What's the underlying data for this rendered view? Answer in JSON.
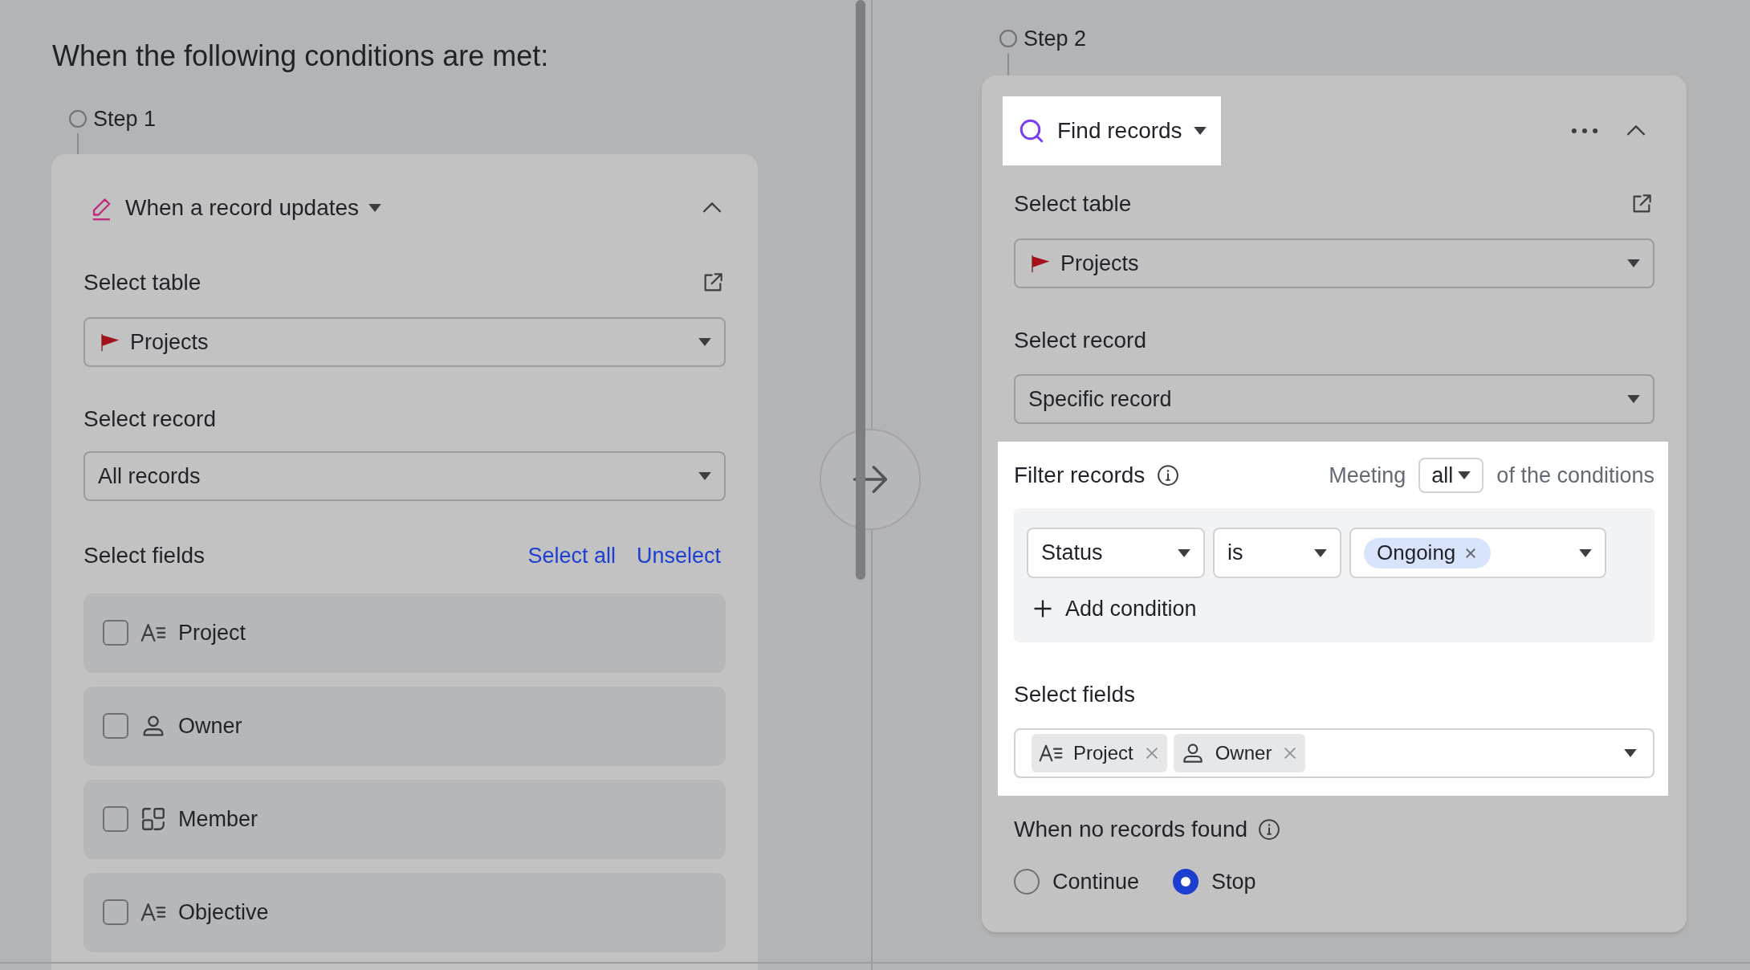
{
  "heading": "When the following conditions are met:",
  "trigger_step": {
    "step": "Step 1",
    "title": "When a record updates",
    "select_table": {
      "label": "Select table",
      "value": "Projects"
    },
    "select_record": {
      "label": "Select record",
      "value": "All records"
    },
    "select_fields": {
      "label": "Select fields",
      "links": [
        "Select all",
        "Unselect"
      ],
      "fields": [
        {
          "name": "Project",
          "kind": "text",
          "checked": false
        },
        {
          "name": "Owner",
          "kind": "person",
          "checked": false
        },
        {
          "name": "Member",
          "kind": "member",
          "checked": false
        },
        {
          "name": "Objective",
          "kind": "text",
          "checked": false
        }
      ]
    }
  },
  "action_step": {
    "step": "Step 2",
    "title": "Find records",
    "select_table": {
      "label": "Select table",
      "value": "Projects"
    },
    "select_record": {
      "label": "Select record",
      "value": "Specific record"
    },
    "filter": {
      "label": "Filter records",
      "meeting": "Meeting",
      "match": "all",
      "suffix": "of the conditions",
      "conditions": [
        {
          "field": "Status",
          "operator": "is",
          "values": [
            "Ongoing"
          ]
        }
      ],
      "add": "Add condition"
    },
    "select_fields": {
      "label": "Select fields",
      "tags": [
        {
          "name": "Project",
          "kind": "text"
        },
        {
          "name": "Owner",
          "kind": "person"
        }
      ]
    },
    "no_records": {
      "label": "When no records found",
      "options": [
        {
          "label": "Continue",
          "selected": false
        },
        {
          "label": "Stop",
          "selected": true
        }
      ]
    }
  }
}
